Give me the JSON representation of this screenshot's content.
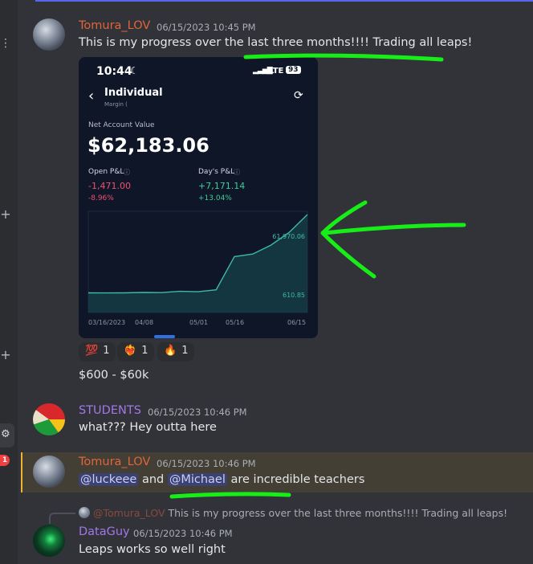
{
  "messages": [
    {
      "author": "Tomura_LOV",
      "author_color": "#e0643c",
      "timestamp": "06/15/2023 10:45 PM",
      "text": "This is my progress over the last three months!!!! Trading all leaps!",
      "reactions": [
        {
          "icon": "hundred-points-icon",
          "glyph": "💯",
          "count": "1"
        },
        {
          "icon": "heart-on-fire-icon",
          "glyph": "❤️‍🔥",
          "count": "1"
        },
        {
          "icon": "fire-icon",
          "glyph": "🔥",
          "count": "1"
        }
      ],
      "followup": "$600 - $60k"
    },
    {
      "author": "STUDENTS",
      "author_color": "#a377e8",
      "timestamp": "06/15/2023 10:46 PM",
      "text": "what??? Hey outta here"
    },
    {
      "author": "Tomura_LOV",
      "author_color": "#e0643c",
      "timestamp": "06/15/2023 10:46 PM",
      "mention1": "@luckeee",
      "mid": "and",
      "mention2": "@Michael",
      "tail": "are incredible teachers"
    },
    {
      "reply_to": {
        "author": "@Tomura_LOV",
        "text": "This is my progress over the last three months!!!! Trading all leaps!"
      },
      "author": "DataGuy",
      "author_color": "#a377e8",
      "timestamp": "06/15/2023 10:46 PM",
      "text": "Leaps works so well right"
    }
  ],
  "screenshot": {
    "status_time": "10:44",
    "network": "LTE",
    "battery": "93",
    "account_title": "Individual",
    "account_sub": "Margin (",
    "nav_label": "Net Account Value",
    "net_value": "$62,183.06",
    "open_pl_label": "Open P&L",
    "open_pl_value": "-1,471.00",
    "open_pl_pct": "-8.96%",
    "days_pl_label": "Day's P&L",
    "days_pl_value": "+7,171.14",
    "days_pl_pct": "+13.04%",
    "positive_color": "#3ccf9a",
    "negative_color": "#f0506e"
  },
  "chart_data": {
    "type": "area",
    "x": [
      "03/16/2023",
      "04/08",
      "05/01",
      "05/16",
      "06/15"
    ],
    "max_label": "61,970.06",
    "min_label": "610.85",
    "values": [
      600,
      550,
      600,
      900,
      800,
      1800,
      1500,
      3000,
      29000,
      31000,
      38000,
      48000,
      61970
    ]
  },
  "rail": {
    "badge": "1"
  }
}
